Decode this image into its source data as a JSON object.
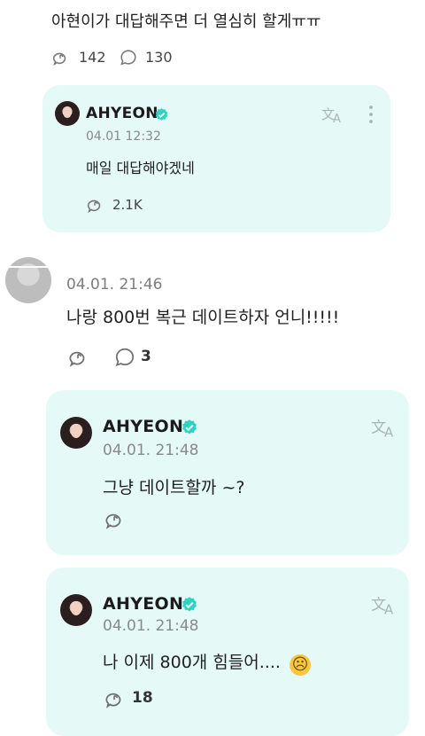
{
  "top_comment": {
    "text": "아현이가 대답해주면 더 열심히 할게ㅠㅠ",
    "likes": "142",
    "replies": "130"
  },
  "reply1": {
    "name": "AHYEON",
    "date": "04.01 12:32",
    "text": "매일 대답해야겠네",
    "likes": "2.1K"
  },
  "comment2": {
    "date": "04.01. 21:46",
    "text": "나랑 800번 복근 데이트하자 언니!!!!!",
    "replies": "3"
  },
  "reply2": {
    "name": "AHYEON",
    "date": "04.01. 21:48",
    "text": "그냥 데이트할까 ~?"
  },
  "reply3": {
    "name": "AHYEON",
    "date": "04.01. 21:48",
    "text": "나 이제 800개 힘들어....",
    "emoji": "☹",
    "likes": "18"
  },
  "colors": {
    "card_bg": "#e5f9f6",
    "badge": "#2fd3c1",
    "translate": "#a9b6b3"
  },
  "icons": [
    "like-icon",
    "comment-icon",
    "verified-badge-icon",
    "translate-icon",
    "more-menu-icon"
  ]
}
